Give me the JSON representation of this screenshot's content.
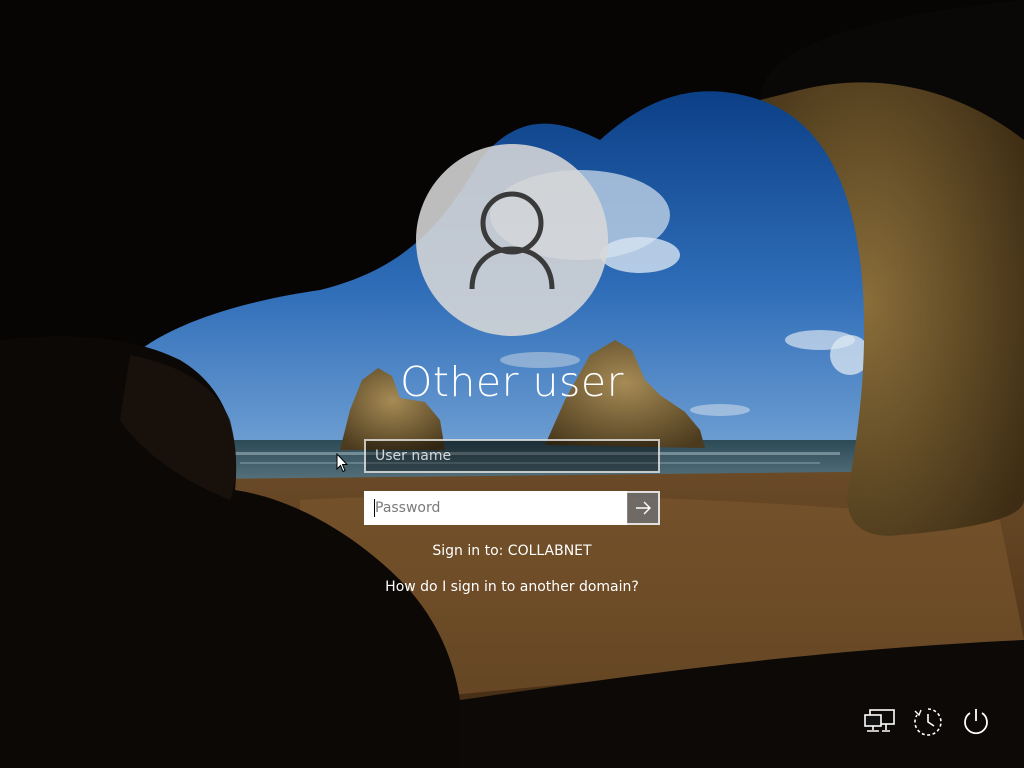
{
  "user": {
    "name": "Other user"
  },
  "login_form": {
    "username_placeholder": "User name",
    "password_placeholder": "Password",
    "submit_icon": "arrow-right-icon"
  },
  "signin_info": {
    "sign_in_to_text": "Sign in to: COLLABNET",
    "domain_help_link": "How do I sign in to another domain?"
  },
  "tray_icons": {
    "network": "network-icon",
    "ease_of_access": "ease-of-access-icon",
    "power": "power-icon"
  },
  "colors": {
    "text": "#ffffff",
    "avatar_bg": "#d7d7d7",
    "submit_bg": "#6e6e6e"
  }
}
